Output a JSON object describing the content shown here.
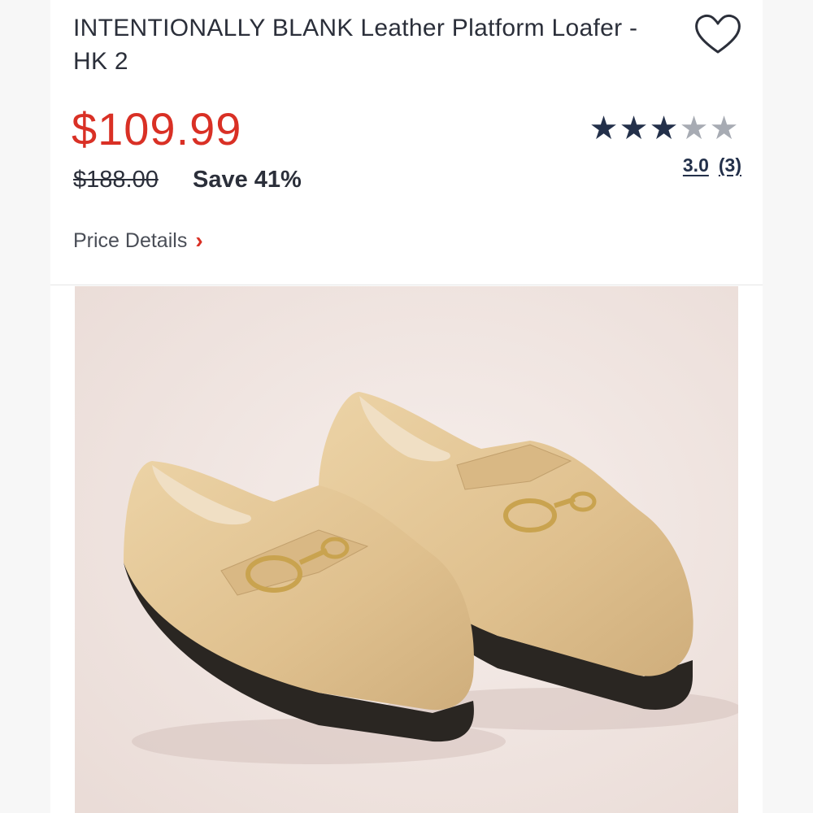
{
  "product": {
    "title": "INTENTIONALLY BLANK Leather Platform Loafer - HK 2",
    "price": "$109.99",
    "original_price": "$188.00",
    "savings": "Save 41%",
    "rating": {
      "value": 3.0,
      "value_label": "3.0",
      "count_label": "(3)",
      "stars_filled": 3,
      "stars_total": 5
    },
    "price_details_label": "Price Details",
    "image_alt": "beige croc-embossed leather platform loafers with gold horsebit"
  },
  "colors": {
    "price_red": "#d93025",
    "star_filled": "#23304a",
    "star_empty": "#a7abb3",
    "text_dark": "#2b2f3a"
  },
  "icons": {
    "wishlist": "heart-outline-icon",
    "chevron": "chevron-right-icon",
    "star": "star-icon"
  }
}
